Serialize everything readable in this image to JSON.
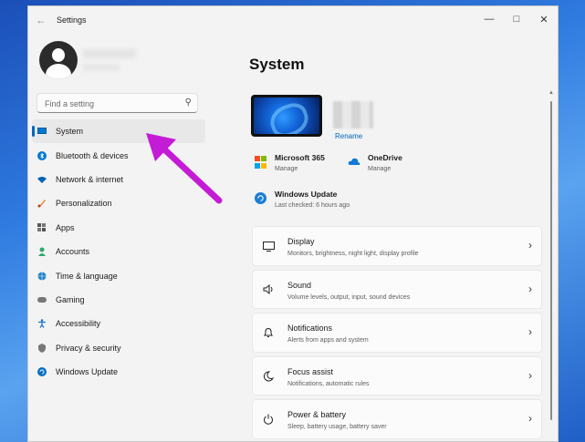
{
  "window": {
    "title": "Settings"
  },
  "search": {
    "placeholder": "Find a setting"
  },
  "nav": [
    {
      "label": "System",
      "icon": "monitor-icon",
      "color": "#0078d4",
      "selected": true
    },
    {
      "label": "Bluetooth & devices",
      "icon": "bluetooth-icon",
      "color": "#0078d4"
    },
    {
      "label": "Network & internet",
      "icon": "wifi-icon",
      "color": "#0063b1"
    },
    {
      "label": "Personalization",
      "icon": "brush-icon",
      "color": "#e08a2c"
    },
    {
      "label": "Apps",
      "icon": "apps-icon",
      "color": "#555555"
    },
    {
      "label": "Accounts",
      "icon": "person-icon",
      "color": "#2ea86b"
    },
    {
      "label": "Time & language",
      "icon": "globe-icon",
      "color": "#1c7fc9"
    },
    {
      "label": "Gaming",
      "icon": "gamepad-icon",
      "color": "#777777"
    },
    {
      "label": "Accessibility",
      "icon": "accessibility-icon",
      "color": "#1a70c8"
    },
    {
      "label": "Privacy & security",
      "icon": "shield-icon",
      "color": "#777777"
    },
    {
      "label": "Windows Update",
      "icon": "update-icon",
      "color": "#0a6fc2"
    }
  ],
  "main": {
    "title": "System",
    "device": {
      "rename_label": "Rename"
    },
    "quick": {
      "ms365": {
        "title": "Microsoft 365",
        "sub": "Manage"
      },
      "onedrive": {
        "title": "OneDrive",
        "sub": "Manage"
      },
      "update": {
        "title": "Windows Update",
        "sub": "Last checked: 6 hours ago"
      }
    },
    "cards": [
      {
        "title": "Display",
        "desc": "Monitors, brightness, night light, display profile",
        "icon": "display-icon"
      },
      {
        "title": "Sound",
        "desc": "Volume levels, output, input, sound devices",
        "icon": "speaker-icon"
      },
      {
        "title": "Notifications",
        "desc": "Alerts from apps and system",
        "icon": "bell-icon"
      },
      {
        "title": "Focus assist",
        "desc": "Notifications, automatic rules",
        "icon": "moon-icon"
      },
      {
        "title": "Power & battery",
        "desc": "Sleep, battery usage, battery saver",
        "icon": "power-icon"
      }
    ]
  },
  "colors": {
    "accent": "#0067c0",
    "annotation_arrow": "#c41bd6"
  }
}
